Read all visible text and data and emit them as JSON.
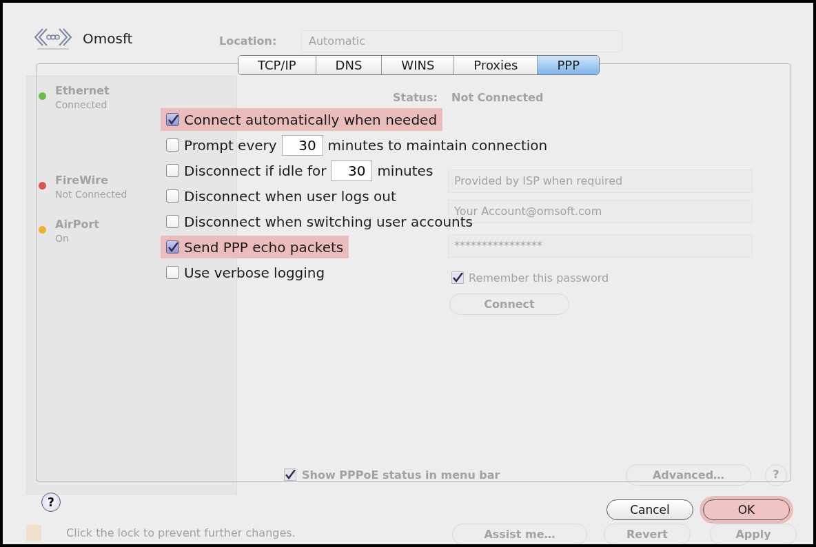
{
  "background": {
    "location_label": "Location:",
    "location_value": "Automatic",
    "services": [
      {
        "name": "Ethernet",
        "status": "Connected",
        "color": "#6cbf45"
      },
      {
        "name": "FireWire",
        "status": "Not Connected",
        "color": "#d9534f"
      },
      {
        "name": "AirPort",
        "status": "On",
        "color": "#f0b030"
      }
    ],
    "status_label": "Status:",
    "status_value": "Not Connected",
    "fields": [
      "Provided by ISP when required",
      "Your Account@omsoft.com",
      "****************"
    ],
    "remember": {
      "label": "Remember this password",
      "checked": true
    },
    "connect_button": "Connect",
    "show_status": {
      "label": "Show PPPoE status in menu bar",
      "checked": true
    },
    "advanced_button": "Advanced…",
    "help_label": "?",
    "lock_text": "Click the lock to prevent further changes.",
    "bottom_buttons": [
      "Assist me…",
      "Revert",
      "Apply"
    ]
  },
  "sheet": {
    "title": "Omosft",
    "tabs": [
      {
        "label": "TCP/IP",
        "selected": false
      },
      {
        "label": "DNS",
        "selected": false
      },
      {
        "label": "WINS",
        "selected": false
      },
      {
        "label": "Proxies",
        "selected": false
      },
      {
        "label": "PPP",
        "selected": true
      }
    ],
    "options": [
      {
        "kind": "plain",
        "label": "Connect automatically when needed",
        "checked": true,
        "highlighted": true
      },
      {
        "kind": "field",
        "label": "Prompt every",
        "value": "30",
        "suffix": "minutes to maintain connection",
        "checked": false,
        "highlighted": false
      },
      {
        "kind": "field",
        "label": "Disconnect if idle for",
        "value": "30",
        "suffix": "minutes",
        "checked": false,
        "highlighted": false
      },
      {
        "kind": "plain",
        "label": "Disconnect when user logs out",
        "checked": false,
        "highlighted": false
      },
      {
        "kind": "plain",
        "label": "Disconnect when switching user accounts",
        "checked": false,
        "highlighted": false
      },
      {
        "kind": "plain",
        "label": "Send PPP echo packets",
        "checked": true,
        "highlighted": true
      },
      {
        "kind": "plain",
        "label": "Use verbose logging",
        "checked": false,
        "highlighted": false
      }
    ],
    "help_label": "?",
    "buttons": [
      {
        "label": "Cancel",
        "highlighted": false
      },
      {
        "label": "OK",
        "highlighted": true
      }
    ]
  }
}
